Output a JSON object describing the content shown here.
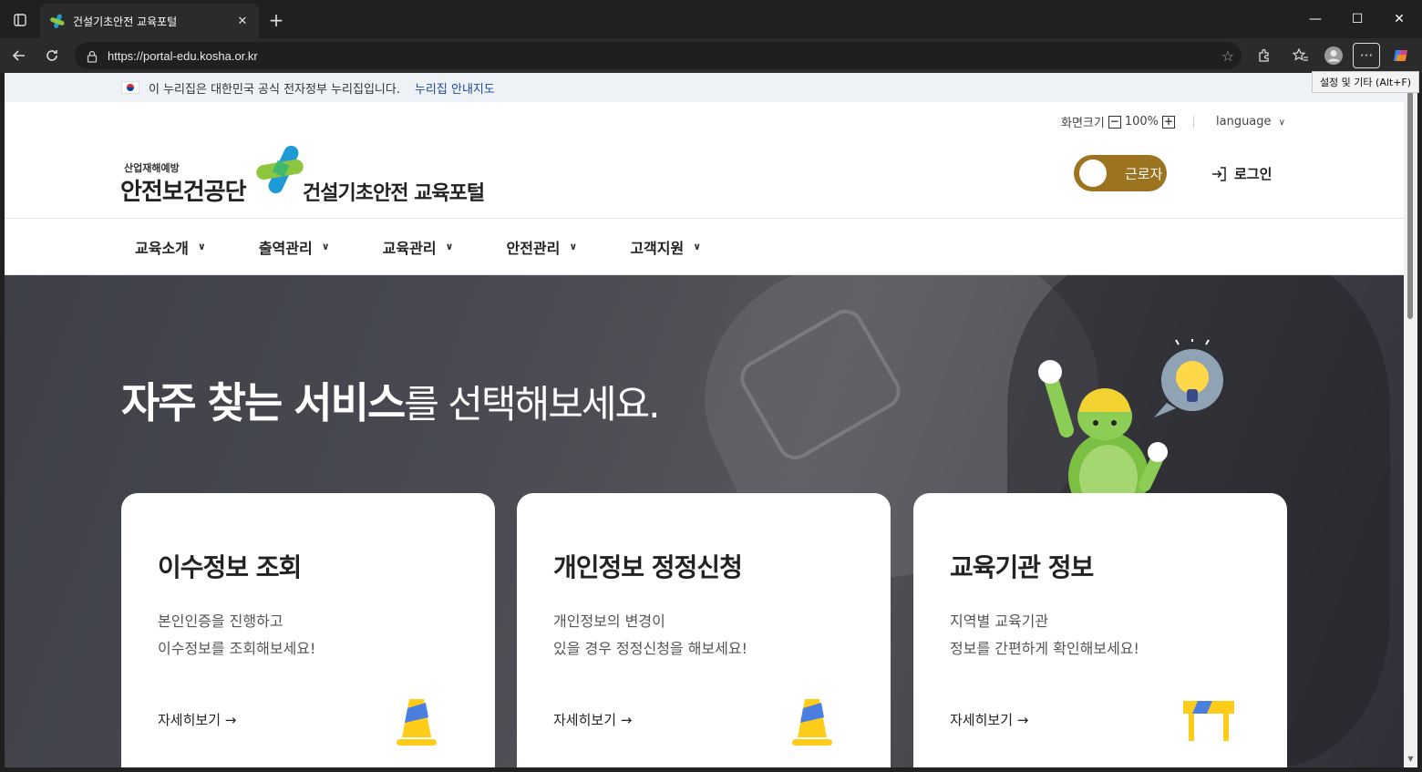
{
  "browser": {
    "tab_title": "건설기초안전 교육포털",
    "tab_close": "✕",
    "new_tab": "+",
    "url": "https://portal-edu.kosha.or.kr",
    "tooltip": "설정 및 기타 (Alt+F)",
    "minimize": "—",
    "maximize": "☐",
    "close": "✕"
  },
  "gov_banner": {
    "text": "이 누리집은 대한민국 공식 전자정부 누리집입니다.",
    "link": "누리집 안내지도"
  },
  "header": {
    "zoom_label": "화면크기",
    "zoom_minus": "−",
    "zoom_value": "100%",
    "zoom_plus": "+",
    "language": "language",
    "logo_small": "산업재해예방",
    "logo_main": "안전보건공단",
    "portal_title": "건설기초안전 교육포털",
    "toggle_label": "근로자",
    "login": "로그인"
  },
  "nav": {
    "items": [
      {
        "label": "교육소개"
      },
      {
        "label": "출역관리"
      },
      {
        "label": "교육관리"
      },
      {
        "label": "안전관리"
      },
      {
        "label": "고객지원"
      }
    ]
  },
  "hero": {
    "title_bold": "자주 찾는 서비스",
    "title_rest": "를 선택해보세요."
  },
  "cards": [
    {
      "title": "이수정보 조회",
      "desc1": "본인인증을 진행하고",
      "desc2": "이수정보를 조회해보세요!",
      "link": "자세히보기 →"
    },
    {
      "title": "개인정보 정정신청",
      "desc1": "개인정보의 변경이",
      "desc2": "있을 경우 정정신청을 해보세요!",
      "link": "자세히보기 →"
    },
    {
      "title": "교육기관 정보",
      "desc1": "지역별 교육기관",
      "desc2": "정보를 간편하게 확인해보세요!",
      "link": "자세히보기 →"
    }
  ],
  "colors": {
    "brand_gold": "#9c7420",
    "gov_link": "#1b4b9b",
    "logo_green": "#8cc63f",
    "logo_blue": "#1e9ad6"
  }
}
